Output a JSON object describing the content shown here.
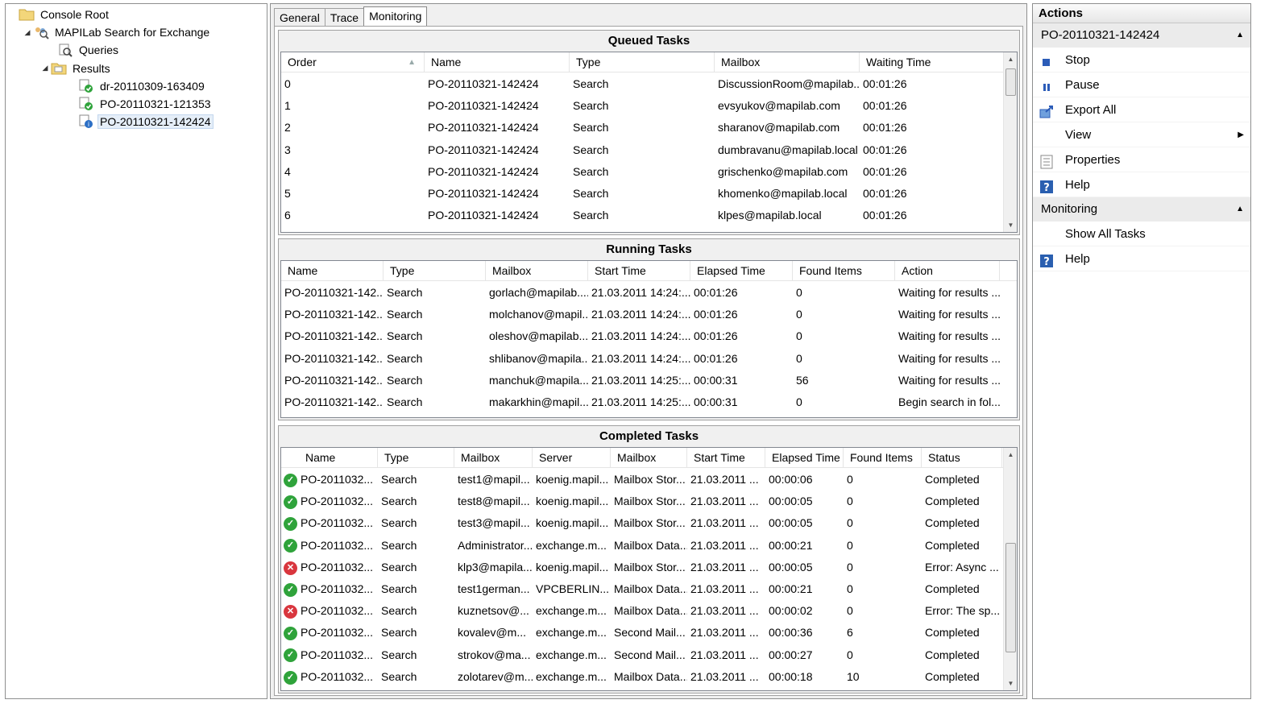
{
  "tree": {
    "items": [
      {
        "label": "Console Root",
        "level": 0,
        "icon": "folder-icon",
        "arrow": ""
      },
      {
        "label": "MAPILab Search for Exchange",
        "level": 1,
        "icon": "search-people-icon",
        "arrow": "◢"
      },
      {
        "label": "Queries",
        "level": 2,
        "icon": "query-icon",
        "arrow": ""
      },
      {
        "label": "Results",
        "level": 2,
        "icon": "results-folder-icon",
        "arrow": "◢"
      },
      {
        "label": "dr-20110309-163409",
        "level": 3,
        "icon": "result-ok-icon",
        "arrow": ""
      },
      {
        "label": "PO-20110321-121353",
        "level": 3,
        "icon": "result-ok-icon",
        "arrow": ""
      },
      {
        "label": "PO-20110321-142424",
        "level": 3,
        "icon": "result-running-icon",
        "arrow": "",
        "selected": true
      }
    ]
  },
  "tabs": [
    {
      "label": "General"
    },
    {
      "label": "Trace"
    },
    {
      "label": "Monitoring",
      "active": true
    }
  ],
  "queued": {
    "title": "Queued Tasks",
    "columns": [
      "Order",
      "Name",
      "Type",
      "Mailbox",
      "Waiting Time"
    ],
    "rows": [
      [
        "0",
        "PO-20110321-142424",
        "Search",
        "DiscussionRoom@mapilab....",
        "00:01:26"
      ],
      [
        "1",
        "PO-20110321-142424",
        "Search",
        "evsyukov@mapilab.com",
        "00:01:26"
      ],
      [
        "2",
        "PO-20110321-142424",
        "Search",
        "sharanov@mapilab.com",
        "00:01:26"
      ],
      [
        "3",
        "PO-20110321-142424",
        "Search",
        "dumbravanu@mapilab.local",
        "00:01:26"
      ],
      [
        "4",
        "PO-20110321-142424",
        "Search",
        "grischenko@mapilab.com",
        "00:01:26"
      ],
      [
        "5",
        "PO-20110321-142424",
        "Search",
        "khomenko@mapilab.local",
        "00:01:26"
      ],
      [
        "6",
        "PO-20110321-142424",
        "Search",
        "klpes@mapilab.local",
        "00:01:26"
      ]
    ]
  },
  "running": {
    "title": "Running Tasks",
    "columns": [
      "Name",
      "Type",
      "Mailbox",
      "Start Time",
      "Elapsed Time",
      "Found Items",
      "Action"
    ],
    "rows": [
      [
        "PO-20110321-142...",
        "Search",
        "gorlach@mapilab....",
        "21.03.2011 14:24:...",
        "00:01:26",
        "0",
        "Waiting for results ..."
      ],
      [
        "PO-20110321-142...",
        "Search",
        "molchanov@mapil...",
        "21.03.2011 14:24:...",
        "00:01:26",
        "0",
        "Waiting for results ..."
      ],
      [
        "PO-20110321-142...",
        "Search",
        "oleshov@mapilab....",
        "21.03.2011 14:24:...",
        "00:01:26",
        "0",
        "Waiting for results ..."
      ],
      [
        "PO-20110321-142...",
        "Search",
        "shlibanov@mapila...",
        "21.03.2011 14:24:...",
        "00:01:26",
        "0",
        "Waiting for results ..."
      ],
      [
        "PO-20110321-142...",
        "Search",
        "manchuk@mapila...",
        "21.03.2011 14:25:...",
        "00:00:31",
        "56",
        "Waiting for results ..."
      ],
      [
        "PO-20110321-142...",
        "Search",
        "makarkhin@mapil...",
        "21.03.2011 14:25:...",
        "00:00:31",
        "0",
        "Begin search in fol..."
      ]
    ]
  },
  "completed": {
    "title": "Completed Tasks",
    "columns": [
      "Name",
      "Type",
      "Mailbox",
      "Server",
      "Mailbox",
      "Start Time",
      "Elapsed Time",
      "Found Items",
      "Status"
    ],
    "rows": [
      {
        "status": "ok",
        "cells": [
          "PO-2011032...",
          "Search",
          "test1@mapil...",
          "koenig.mapil...",
          "Mailbox Stor...",
          "21.03.2011 ...",
          "00:00:06",
          "0",
          "Completed"
        ]
      },
      {
        "status": "ok",
        "cells": [
          "PO-2011032...",
          "Search",
          "test8@mapil...",
          "koenig.mapil...",
          "Mailbox Stor...",
          "21.03.2011 ...",
          "00:00:05",
          "0",
          "Completed"
        ]
      },
      {
        "status": "ok",
        "cells": [
          "PO-2011032...",
          "Search",
          "test3@mapil...",
          "koenig.mapil...",
          "Mailbox Stor...",
          "21.03.2011 ...",
          "00:00:05",
          "0",
          "Completed"
        ]
      },
      {
        "status": "ok",
        "cells": [
          "PO-2011032...",
          "Search",
          "Administrator...",
          "exchange.m...",
          "Mailbox Data...",
          "21.03.2011 ...",
          "00:00:21",
          "0",
          "Completed"
        ]
      },
      {
        "status": "err",
        "cells": [
          "PO-2011032...",
          "Search",
          "klp3@mapila...",
          "koenig.mapil...",
          "Mailbox Stor...",
          "21.03.2011 ...",
          "00:00:05",
          "0",
          "Error: Async ..."
        ]
      },
      {
        "status": "ok",
        "cells": [
          "PO-2011032...",
          "Search",
          "test1german...",
          "VPCBERLIN...",
          "Mailbox Data...",
          "21.03.2011 ...",
          "00:00:21",
          "0",
          "Completed"
        ]
      },
      {
        "status": "err",
        "cells": [
          "PO-2011032...",
          "Search",
          "kuznetsov@...",
          "exchange.m...",
          "Mailbox Data...",
          "21.03.2011 ...",
          "00:00:02",
          "0",
          "Error: The sp..."
        ]
      },
      {
        "status": "ok",
        "cells": [
          "PO-2011032...",
          "Search",
          "kovalev@m...",
          "exchange.m...",
          "Second Mail...",
          "21.03.2011 ...",
          "00:00:36",
          "6",
          "Completed"
        ]
      },
      {
        "status": "ok",
        "cells": [
          "PO-2011032...",
          "Search",
          "strokov@ma...",
          "exchange.m...",
          "Second Mail...",
          "21.03.2011 ...",
          "00:00:27",
          "0",
          "Completed"
        ]
      },
      {
        "status": "ok",
        "cells": [
          "PO-2011032...",
          "Search",
          "zolotarev@m...",
          "exchange.m...",
          "Mailbox Data...",
          "21.03.2011 ...",
          "00:00:18",
          "10",
          "Completed"
        ]
      }
    ]
  },
  "actions": {
    "header": "Actions",
    "sections": [
      {
        "title": "PO-20110321-142424",
        "items": [
          {
            "label": "Stop",
            "icon": "stop-icon"
          },
          {
            "label": "Pause",
            "icon": "pause-icon"
          },
          {
            "label": "Export All",
            "icon": "export-icon"
          },
          {
            "label": "View",
            "icon": "",
            "submenu": true
          },
          {
            "label": "Properties",
            "icon": "properties-icon"
          },
          {
            "label": "Help",
            "icon": "help-icon"
          }
        ]
      },
      {
        "title": "Monitoring",
        "items": [
          {
            "label": "Show All Tasks",
            "icon": ""
          },
          {
            "label": "Help",
            "icon": "help-icon"
          }
        ]
      }
    ]
  },
  "colors": {
    "ok": "#2fa33b",
    "error": "#d9363e",
    "help": "#2a5fb0",
    "stop": "#2b5cb8"
  }
}
